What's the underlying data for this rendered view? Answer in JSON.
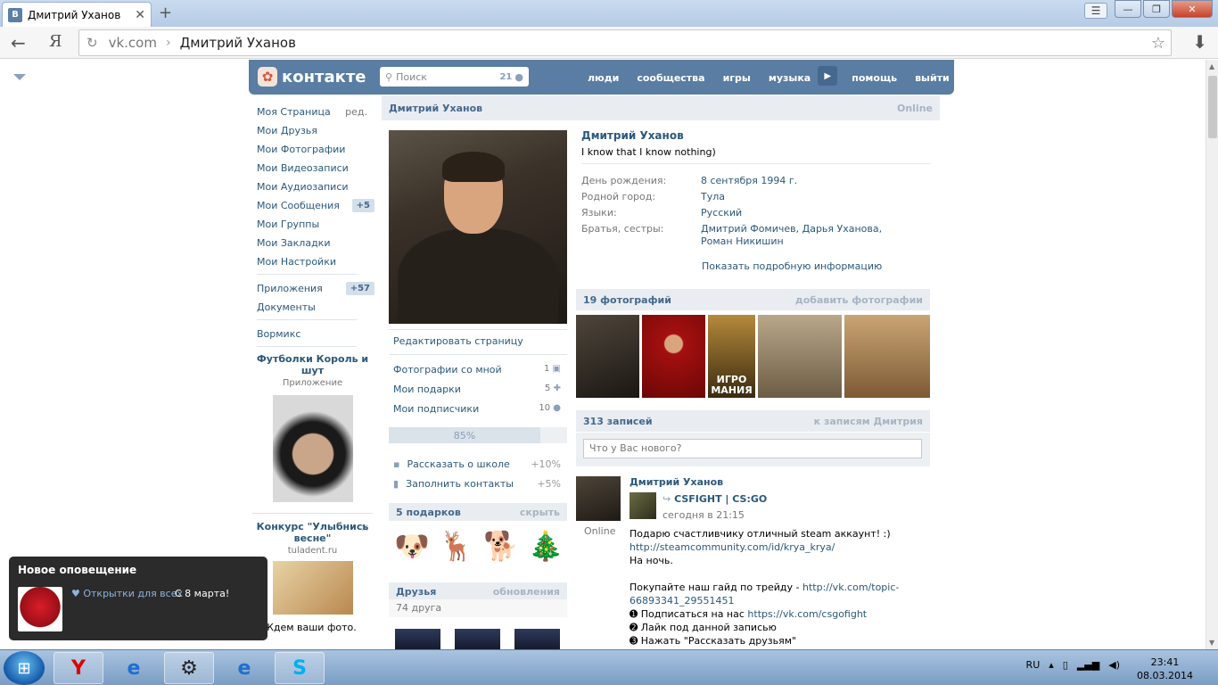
{
  "browser": {
    "tab_title": "Дмитрий Уханов",
    "tab_favicon": "В",
    "url_domain": "vk.com",
    "url_page": "Дмитрий Уханов",
    "yandex_label": "Я"
  },
  "header": {
    "logo": "контакте",
    "search_placeholder": "Поиск",
    "search_count": "21",
    "nav": [
      "люди",
      "сообщества",
      "игры",
      "музыка",
      "помощь",
      "выйти"
    ]
  },
  "left_menu": {
    "items": [
      {
        "label": "Моя Страница",
        "extra": "ред."
      },
      {
        "label": "Мои Друзья"
      },
      {
        "label": "Мои Фотографии"
      },
      {
        "label": "Мои Видеозаписи"
      },
      {
        "label": "Мои Аудиозаписи"
      },
      {
        "label": "Мои Сообщения",
        "badge": "+5"
      },
      {
        "label": "Мои Группы"
      },
      {
        "label": "Мои Закладки"
      },
      {
        "label": "Мои Настройки"
      }
    ],
    "items2": [
      {
        "label": "Приложения",
        "badge": "+57"
      },
      {
        "label": "Документы"
      }
    ],
    "items3": [
      {
        "label": "Вормикс"
      }
    ],
    "ad1_title": "Футболки Король и шут",
    "ad1_sub": "Приложение",
    "ad2_title": "Конкурс \"Улыбнись весне\"",
    "ad2_sub": "tuladent.ru",
    "ad2_text": "Ждем ваши фото."
  },
  "profile": {
    "name": "Дмитрий Уханов",
    "online": "Online",
    "status": "I know that I know nothing)",
    "info": [
      {
        "k": "День рождения:",
        "v": "8 сентября 1994 г."
      },
      {
        "k": "Родной город:",
        "v": "Тула"
      },
      {
        "k": "Языки:",
        "v": "Русский"
      },
      {
        "k": "Братья, сестры:",
        "v": "Дмитрий Фомичев, Дарья Уханова, Роман Никишин"
      }
    ],
    "more": "Показать подробную информацию",
    "edit": "Редактировать страницу",
    "links": [
      {
        "label": "Фотографии со мной",
        "count": "1"
      },
      {
        "label": "Мои подарки",
        "count": "5"
      },
      {
        "label": "Мои подписчики",
        "count": "10"
      }
    ],
    "progress_label": "85%",
    "progress_value": 0.85,
    "tips": [
      {
        "label": "Рассказать о школе",
        "bonus": "+10%"
      },
      {
        "label": "Заполнить контакты",
        "bonus": "+5%"
      }
    ],
    "gifts_title": "5 подарков",
    "gifts_hide": "скрыть",
    "friends_title": "Друзья",
    "friends_updates": "обновления",
    "friends_count": "74 друга"
  },
  "photos": {
    "title": "19 фотографий",
    "add": "добавить фотографии",
    "thumb_overlay": "ИГРО МАНИЯ"
  },
  "wall": {
    "title": "313 записей",
    "to_wall": "к записям Дмитрия",
    "placeholder": "Что у Вас нового?",
    "post": {
      "author": "Дмитрий Уханов",
      "online": "Online",
      "group": "CSFIGHT | CS:GO",
      "time": "сегодня в 21:15",
      "line1": "Подарю счастливчику отличный steam аккаунт! :)",
      "link1": "http://steamcommunity.com/id/krya_krya/",
      "line2": "На ночь.",
      "line3": "Покупайте наш гайд по трейду - ",
      "link2": "http://vk.com/topic-66893341_29551451",
      "step1": "➊ Подписаться на нас ",
      "link3": "https://vk.com/csgofight",
      "step2": "➋ Лайк под данной записью",
      "step3": "➌ Нажать \"Рассказать друзьям\""
    }
  },
  "notification": {
    "title": "Новое оповещение",
    "link": "♥ Открытки для всех",
    "text": "С 8 марта!"
  },
  "taskbar": {
    "lang": "RU",
    "time": "23:41",
    "date": "08.03.2014"
  }
}
